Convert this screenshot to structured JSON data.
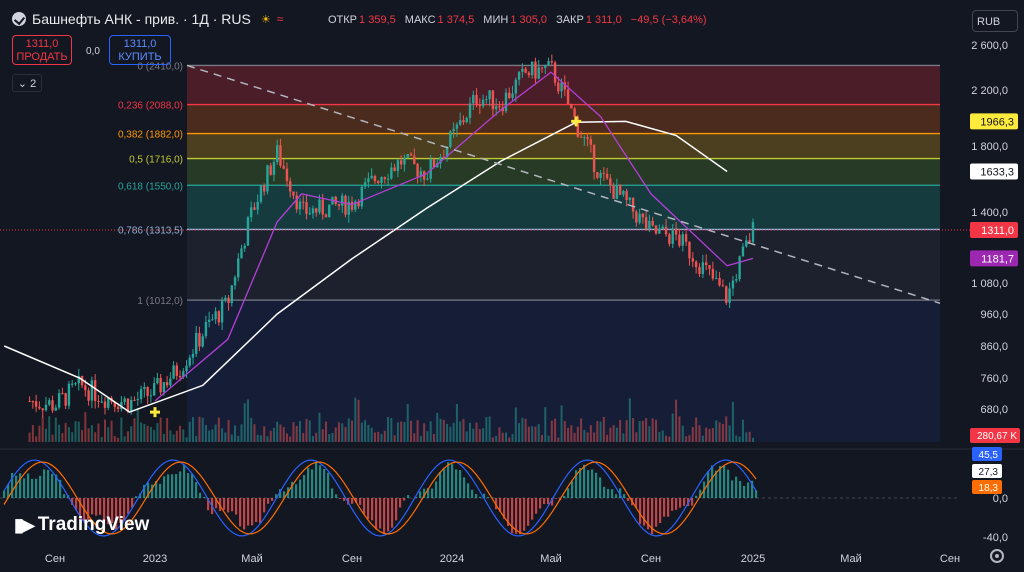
{
  "header": {
    "title": "Башнефть АНК - прив. · 1Д · RUS",
    "ohlc": [
      {
        "label": "ОТКР",
        "value": "1 359,5"
      },
      {
        "label": "МАКС",
        "value": "1 374,5"
      },
      {
        "label": "МИН",
        "value": "1 305,0"
      },
      {
        "label": "ЗАКР",
        "value": "1 311,0"
      }
    ],
    "change": "−49,5 (−3,64%)"
  },
  "trade": {
    "sell_price": "1311,0",
    "sell_label": "ПРОДАТЬ",
    "spread": "0,0",
    "buy_price": "1311,0",
    "buy_label": "КУПИТЬ"
  },
  "collapse_count": "2",
  "currency": "RUB",
  "brand": "TradingView",
  "colors": {
    "up": "#26a69a",
    "down": "#ef5350",
    "ma_fast": "#b23fd6",
    "ma_slow": "#ffffff",
    "rsi_blue": "#2962ff",
    "rsi_orange": "#ff6d00"
  },
  "chart_data": {
    "type": "candlestick",
    "symbol": "Башнефть АНК - прив.",
    "timeframe": "1Д",
    "y_axis_labels": [
      "2 600,0",
      "2 200,0",
      "1 800,0",
      "1 400,0",
      "1 080,0",
      "960,0",
      "860,0",
      "760,0",
      "680,0"
    ],
    "y_ticks": [
      2600,
      2200,
      1800,
      1400,
      1080,
      960,
      860,
      760,
      680
    ],
    "x_axis_labels": [
      "Сен",
      "2023",
      "Май",
      "Сен",
      "2024",
      "Май",
      "Сен",
      "2025",
      "Май",
      "Сен"
    ],
    "fib_levels": [
      {
        "label": "0 (2410,0)",
        "value": 2410
      },
      {
        "label": "0,236 (2088,0)",
        "value": 2088
      },
      {
        "label": "0,382 (1882,0)",
        "value": 1882
      },
      {
        "label": "0,5 (1716,0)",
        "value": 1716
      },
      {
        "label": "0,618 (1550,0)",
        "value": 1550
      },
      {
        "label": "0,786 (1313,5)",
        "value": 1313.5
      },
      {
        "label": "1 (1012,0)",
        "value": 1012
      }
    ],
    "price_badges": [
      {
        "label": "1966,3",
        "value": 1966.3,
        "color": "#ffeb3b"
      },
      {
        "label": "1633,3",
        "value": 1633.3,
        "color": "#ffffff"
      },
      {
        "label": "1311,0",
        "value": 1311.0,
        "color": "#f23645"
      },
      {
        "label": "1181,7",
        "value": 1181.7,
        "color": "#9c27b0"
      }
    ],
    "volume_badge": "280,67 K",
    "close_series": [
      {
        "date": "2022-08-01",
        "close": 700
      },
      {
        "date": "2022-09-01",
        "close": 690
      },
      {
        "date": "2022-10-01",
        "close": 740
      },
      {
        "date": "2022-11-01",
        "close": 710
      },
      {
        "date": "2022-12-01",
        "close": 695
      },
      {
        "date": "2023-01-01",
        "close": 725
      },
      {
        "date": "2023-02-01",
        "close": 790
      },
      {
        "date": "2023-03-01",
        "close": 900
      },
      {
        "date": "2023-04-01",
        "close": 1000
      },
      {
        "date": "2023-05-01",
        "close": 1400
      },
      {
        "date": "2023-06-01",
        "close": 1750
      },
      {
        "date": "2023-07-01",
        "close": 1400
      },
      {
        "date": "2023-08-01",
        "close": 1420
      },
      {
        "date": "2023-09-01",
        "close": 1450
      },
      {
        "date": "2023-10-01",
        "close": 1600
      },
      {
        "date": "2023-11-01",
        "close": 1700
      },
      {
        "date": "2023-12-01",
        "close": 1620
      },
      {
        "date": "2024-01-01",
        "close": 1850
      },
      {
        "date": "2024-02-01",
        "close": 2150
      },
      {
        "date": "2024-03-01",
        "close": 2100
      },
      {
        "date": "2024-04-01",
        "close": 2350
      },
      {
        "date": "2024-05-01",
        "close": 2380
      },
      {
        "date": "2024-06-01",
        "close": 1950
      },
      {
        "date": "2024-07-01",
        "close": 1600
      },
      {
        "date": "2024-08-01",
        "close": 1450
      },
      {
        "date": "2024-09-01",
        "close": 1300
      },
      {
        "date": "2024-10-01",
        "close": 1280
      },
      {
        "date": "2024-11-01",
        "close": 1150
      },
      {
        "date": "2024-12-01",
        "close": 1020
      },
      {
        "date": "2025-01-01",
        "close": 1311
      }
    ],
    "ma_fast_series": [
      {
        "date": "2023-01-01",
        "value": 700
      },
      {
        "date": "2023-04-01",
        "value": 880
      },
      {
        "date": "2023-06-01",
        "value": 1350
      },
      {
        "date": "2023-07-01",
        "value": 1500
      },
      {
        "date": "2023-09-01",
        "value": 1440
      },
      {
        "date": "2023-12-01",
        "value": 1620
      },
      {
        "date": "2024-03-01",
        "value": 2050
      },
      {
        "date": "2024-05-01",
        "value": 2350
      },
      {
        "date": "2024-07-01",
        "value": 2000
      },
      {
        "date": "2024-09-01",
        "value": 1500
      },
      {
        "date": "2024-12-01",
        "value": 1150
      },
      {
        "date": "2025-01-01",
        "value": 1181.7
      }
    ],
    "ma_slow_series": [
      {
        "date": "2022-07-01",
        "value": 860
      },
      {
        "date": "2022-10-01",
        "value": 760
      },
      {
        "date": "2022-12-01",
        "value": 672
      },
      {
        "date": "2023-03-01",
        "value": 740
      },
      {
        "date": "2023-06-01",
        "value": 960
      },
      {
        "date": "2023-09-01",
        "value": 1180
      },
      {
        "date": "2023-12-01",
        "value": 1420
      },
      {
        "date": "2024-03-01",
        "value": 1700
      },
      {
        "date": "2024-06-01",
        "value": 1960
      },
      {
        "date": "2024-08-01",
        "value": 1966
      },
      {
        "date": "2024-10-01",
        "value": 1870
      },
      {
        "date": "2024-12-01",
        "value": 1633.3
      }
    ],
    "trendline": {
      "from": {
        "date": "2023-01-01",
        "value": 2410
      },
      "to": {
        "date": "2025-09-01",
        "value": 1000
      }
    },
    "rsi": {
      "y_labels": [
        "0,0",
        "-40,0"
      ],
      "values": [
        {
          "label": "45,5",
          "color": "#2962ff"
        },
        {
          "label": "27,3",
          "color": "#ffffff"
        },
        {
          "label": "18,3",
          "color": "#ff6d00"
        }
      ]
    }
  }
}
